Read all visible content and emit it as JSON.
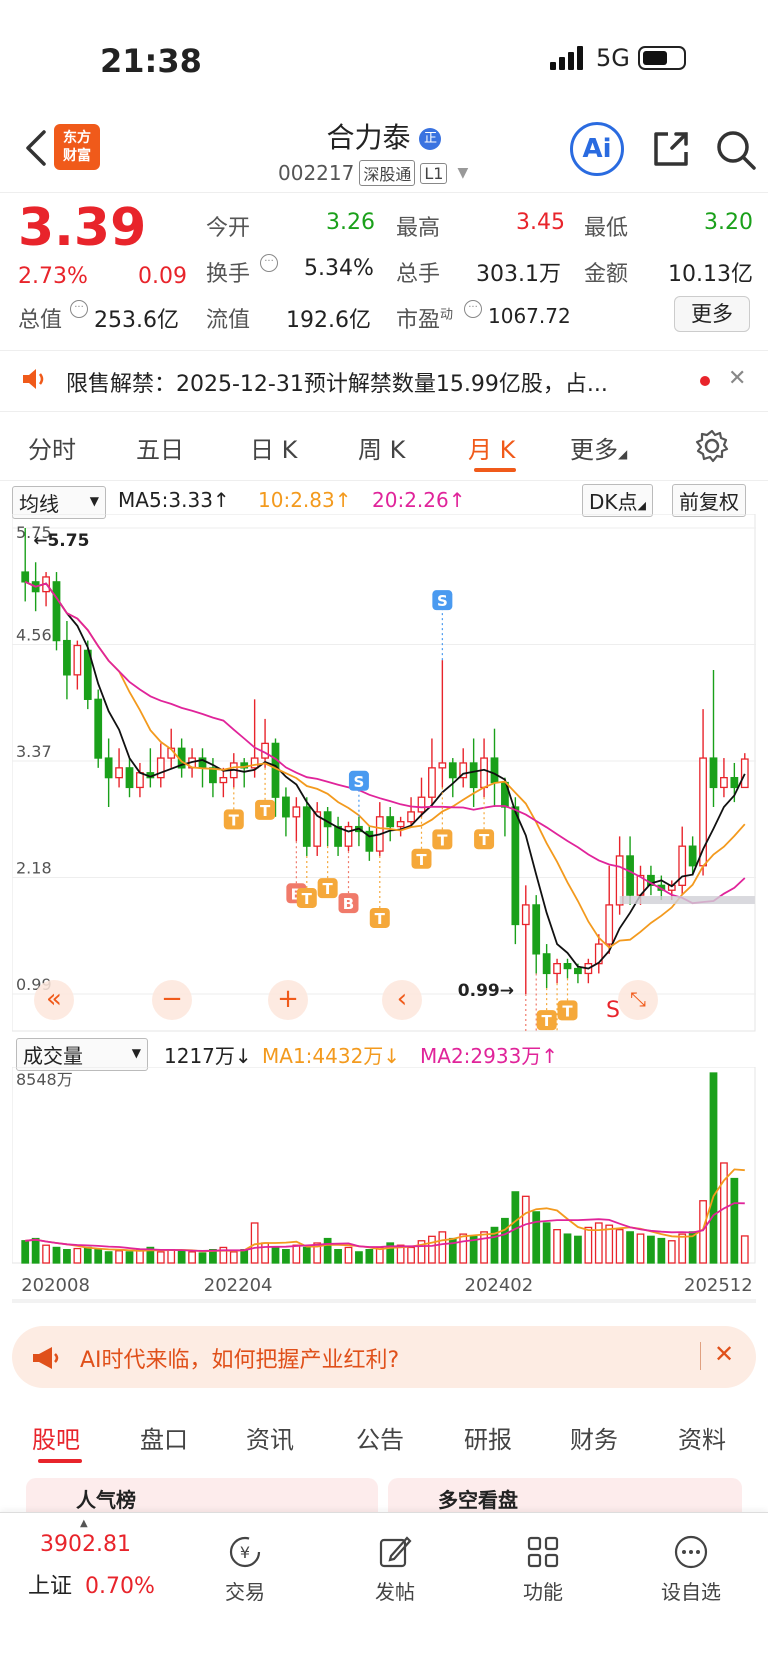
{
  "status_bar": {
    "time": "21:38",
    "network": "5G"
  },
  "header": {
    "logo_line1": "东方",
    "logo_line2": "财富",
    "stock_name": "合力泰",
    "badge": "正",
    "stock_code": "002217",
    "tag_exchange": "深股通",
    "tag_level": "L1",
    "ai_label": "Ai"
  },
  "quote": {
    "price": "3.39",
    "change_pct": "2.73%",
    "change": "0.09",
    "open_label": "今开",
    "open": "3.26",
    "high_label": "最高",
    "high": "3.45",
    "low_label": "最低",
    "low": "3.20",
    "turnover_label": "换手",
    "turnover": "5.34%",
    "volume_label": "总手",
    "volume": "303.1万",
    "amount_label": "金额",
    "amount": "10.13亿",
    "mktcap_label": "总值",
    "mktcap": "253.6亿",
    "float_label": "流值",
    "float_cap": "192.6亿",
    "pe_label": "市盈",
    "pe_sup": "动",
    "pe": "1067.72",
    "more": "更多"
  },
  "notice": {
    "text": "限售解禁：2025-12-31预计解禁数量15.99亿股，占..."
  },
  "kline_tabs": [
    "分时",
    "五日",
    "日 K",
    "周 K",
    "月 K",
    "更多"
  ],
  "ma_row": {
    "indicator": "均线",
    "ma5": "MA5:3.33↑",
    "ma10": "10:2.83↑",
    "ma20": "20:2.26↑",
    "dk": "DK点",
    "adjust": "前复权"
  },
  "colors": {
    "up": "#e8242b",
    "down": "#1aa01a",
    "ma5": "#111111",
    "ma10": "#f39a1e",
    "ma20": "#e0249a",
    "accent": "#f05a1a"
  },
  "chart_data": [
    {
      "type": "candlestick",
      "y_ticks": [
        "5.75",
        "4.56",
        "3.37",
        "2.18",
        "0.99"
      ],
      "ylim": [
        0.99,
        5.75
      ],
      "high_label": "5.75",
      "low_label": "0.99",
      "markers": [
        "T",
        "B",
        "S"
      ],
      "series": [
        {
          "name": "MA5",
          "color": "#111111"
        },
        {
          "name": "MA10",
          "color": "#f39a1e"
        },
        {
          "name": "MA20",
          "color": "#e0249a"
        }
      ],
      "candles": [
        [
          5.3,
          5.2,
          5.75,
          5.0
        ],
        [
          5.2,
          5.1,
          5.4,
          4.9
        ],
        [
          5.1,
          5.25,
          5.3,
          4.95
        ],
        [
          5.2,
          4.6,
          5.3,
          4.5
        ],
        [
          4.6,
          4.25,
          4.8,
          4.0
        ],
        [
          4.25,
          4.55,
          4.6,
          4.1
        ],
        [
          4.5,
          4.0,
          4.6,
          3.9
        ],
        [
          4.0,
          3.4,
          4.1,
          3.3
        ],
        [
          3.4,
          3.2,
          3.6,
          2.9
        ],
        [
          3.2,
          3.3,
          3.5,
          3.1
        ],
        [
          3.3,
          3.1,
          3.4,
          3.0
        ],
        [
          3.1,
          3.25,
          3.35,
          3.0
        ],
        [
          3.25,
          3.2,
          3.5,
          3.1
        ],
        [
          3.2,
          3.4,
          3.55,
          3.1
        ],
        [
          3.4,
          3.5,
          3.7,
          3.3
        ],
        [
          3.5,
          3.3,
          3.6,
          3.2
        ],
        [
          3.3,
          3.4,
          3.5,
          3.2
        ],
        [
          3.4,
          3.3,
          3.5,
          3.1
        ],
        [
          3.3,
          3.15,
          3.4,
          3.0
        ],
        [
          3.15,
          3.2,
          3.3,
          3.0
        ],
        [
          3.2,
          3.35,
          3.45,
          3.1
        ],
        [
          3.35,
          3.3,
          3.4,
          3.1
        ],
        [
          3.3,
          3.4,
          4.0,
          3.2
        ],
        [
          3.4,
          3.55,
          3.8,
          3.3
        ],
        [
          3.55,
          3.0,
          3.6,
          2.8
        ],
        [
          3.0,
          2.8,
          3.1,
          2.6
        ],
        [
          2.8,
          2.9,
          3.0,
          2.55
        ],
        [
          2.9,
          2.5,
          3.0,
          2.4
        ],
        [
          2.5,
          2.85,
          2.95,
          2.4
        ],
        [
          2.85,
          2.7,
          2.9,
          2.5
        ],
        [
          2.7,
          2.5,
          2.8,
          2.4
        ],
        [
          2.5,
          2.7,
          2.75,
          2.45
        ],
        [
          2.7,
          2.65,
          2.8,
          2.5
        ],
        [
          2.65,
          2.45,
          2.7,
          2.35
        ],
        [
          2.45,
          2.8,
          2.95,
          2.4
        ],
        [
          2.8,
          2.7,
          2.9,
          2.55
        ],
        [
          2.7,
          2.75,
          2.8,
          2.6
        ],
        [
          2.75,
          2.85,
          3.0,
          2.7
        ],
        [
          2.85,
          3.0,
          3.2,
          2.8
        ],
        [
          3.0,
          3.3,
          3.6,
          2.9
        ],
        [
          3.3,
          3.35,
          4.4,
          3.1
        ],
        [
          3.35,
          3.2,
          3.4,
          3.0
        ],
        [
          3.2,
          3.35,
          3.5,
          3.1
        ],
        [
          3.35,
          3.1,
          3.6,
          2.9
        ],
        [
          3.1,
          3.4,
          3.6,
          3.0
        ],
        [
          3.4,
          3.15,
          3.7,
          2.9
        ],
        [
          3.15,
          2.9,
          3.2,
          2.6
        ],
        [
          2.9,
          1.7,
          3.0,
          1.5
        ],
        [
          1.7,
          1.9,
          2.1,
          0.99
        ],
        [
          1.9,
          1.4,
          2.0,
          1.2
        ],
        [
          1.4,
          1.2,
          1.5,
          1.05
        ],
        [
          1.2,
          1.3,
          1.35,
          1.1
        ],
        [
          1.3,
          1.25,
          1.35,
          1.15
        ],
        [
          1.25,
          1.2,
          1.3,
          1.1
        ],
        [
          1.2,
          1.3,
          1.35,
          1.1
        ],
        [
          1.3,
          1.5,
          1.6,
          1.2
        ],
        [
          1.5,
          1.9,
          2.3,
          1.4
        ],
        [
          1.9,
          2.4,
          2.6,
          1.8
        ],
        [
          2.4,
          2.0,
          2.6,
          1.9
        ],
        [
          2.0,
          2.2,
          2.3,
          1.9
        ],
        [
          2.2,
          2.1,
          2.3,
          2.0
        ],
        [
          2.1,
          2.05,
          2.2,
          1.95
        ],
        [
          2.05,
          2.1,
          2.15,
          1.95
        ],
        [
          2.1,
          2.5,
          2.7,
          2.0
        ],
        [
          2.5,
          2.3,
          2.6,
          2.2
        ],
        [
          2.3,
          3.4,
          3.9,
          2.2
        ],
        [
          3.4,
          3.1,
          4.3,
          2.9
        ],
        [
          3.1,
          3.2,
          3.4,
          3.0
        ],
        [
          3.2,
          3.1,
          3.35,
          2.95
        ],
        [
          3.1,
          3.39,
          3.45,
          3.2
        ]
      ]
    },
    {
      "type": "bar",
      "indicator": "成交量",
      "latest": "1217万↓",
      "ma1": "MA1:4432万↓",
      "ma2": "MA2:2933万↑",
      "y_top_label": "8548万",
      "x_ticks": [
        "202008",
        "202204",
        "202402",
        "202512"
      ],
      "series": [
        {
          "name": "MA1",
          "color": "#f39a1e"
        },
        {
          "name": "MA2",
          "color": "#e0249a"
        }
      ],
      "volumes": [
        1000,
        1100,
        800,
        700,
        600,
        650,
        700,
        600,
        500,
        550,
        500,
        600,
        700,
        500,
        600,
        550,
        500,
        450,
        600,
        700,
        500,
        600,
        1800,
        900,
        700,
        600,
        800,
        700,
        900,
        1100,
        600,
        700,
        500,
        600,
        700,
        900,
        800,
        700,
        1000,
        1200,
        1400,
        1100,
        1300,
        1200,
        1400,
        1600,
        2000,
        3200,
        3000,
        2300,
        1800,
        1500,
        1300,
        1200,
        1600,
        1800,
        1700,
        1500,
        1400,
        1300,
        1200,
        1100,
        1000,
        1300,
        1400,
        2800,
        8548,
        4500,
        3800,
        1217
      ]
    }
  ],
  "chart_buttons": [
    "«",
    "−",
    "+",
    "‹",
    "S"
  ],
  "ai_banner": {
    "text": "AI时代来临，如何把握产业红利?"
  },
  "bottom_tabs": [
    "股吧",
    "盘口",
    "资讯",
    "公告",
    "研报",
    "财务",
    "资料"
  ],
  "peek_cards": [
    "人气榜",
    "多空看盘"
  ],
  "bottom_nav": {
    "index_value": "3902.81",
    "index_name": "上证",
    "index_pct": "0.70%",
    "items": [
      "交易",
      "发帖",
      "功能",
      "设自选"
    ]
  }
}
